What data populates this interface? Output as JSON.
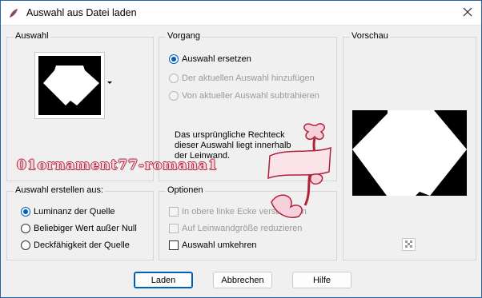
{
  "window": {
    "title": "Auswahl aus Datei laden"
  },
  "auswahl_group": {
    "label": "Auswahl"
  },
  "vorgang_group": {
    "label": "Vorgang",
    "options": [
      {
        "label": "Auswahl ersetzen",
        "checked": true,
        "disabled": false
      },
      {
        "label": "Der aktuellen Auswahl hinzufügen",
        "checked": false,
        "disabled": true
      },
      {
        "label": "Von aktueller Auswahl subtrahieren",
        "checked": false,
        "disabled": true
      }
    ],
    "info_text": "Das ursprüngliche Rechteck dieser Auswahl liegt innerhalb der Leinwand."
  },
  "watermark": {
    "text": "01ornament77-romana1"
  },
  "vorschau_group": {
    "label": "Vorschau"
  },
  "auswahl_erstellen_group": {
    "label": "Auswahl erstellen aus:",
    "options": [
      {
        "label": "Luminanz der Quelle",
        "checked": true
      },
      {
        "label": "Beliebiger Wert außer Null",
        "checked": false
      },
      {
        "label": "Deckfähigkeit der Quelle",
        "checked": false
      }
    ]
  },
  "optionen_group": {
    "label": "Optionen",
    "options": [
      {
        "label": "In obere linke Ecke verschieben",
        "checked": false,
        "disabled": true
      },
      {
        "label": "Auf Leinwandgröße reduzieren",
        "checked": false,
        "disabled": true
      },
      {
        "label": "Auswahl umkehren",
        "checked": false,
        "disabled": false
      }
    ]
  },
  "buttons": {
    "load": "Laden",
    "cancel": "Abbrechen",
    "help": "Hilfe"
  },
  "colors": {
    "accent": "#005fb8",
    "watermark_red": "#b0223a",
    "disabled_text": "#9a9a9a"
  }
}
